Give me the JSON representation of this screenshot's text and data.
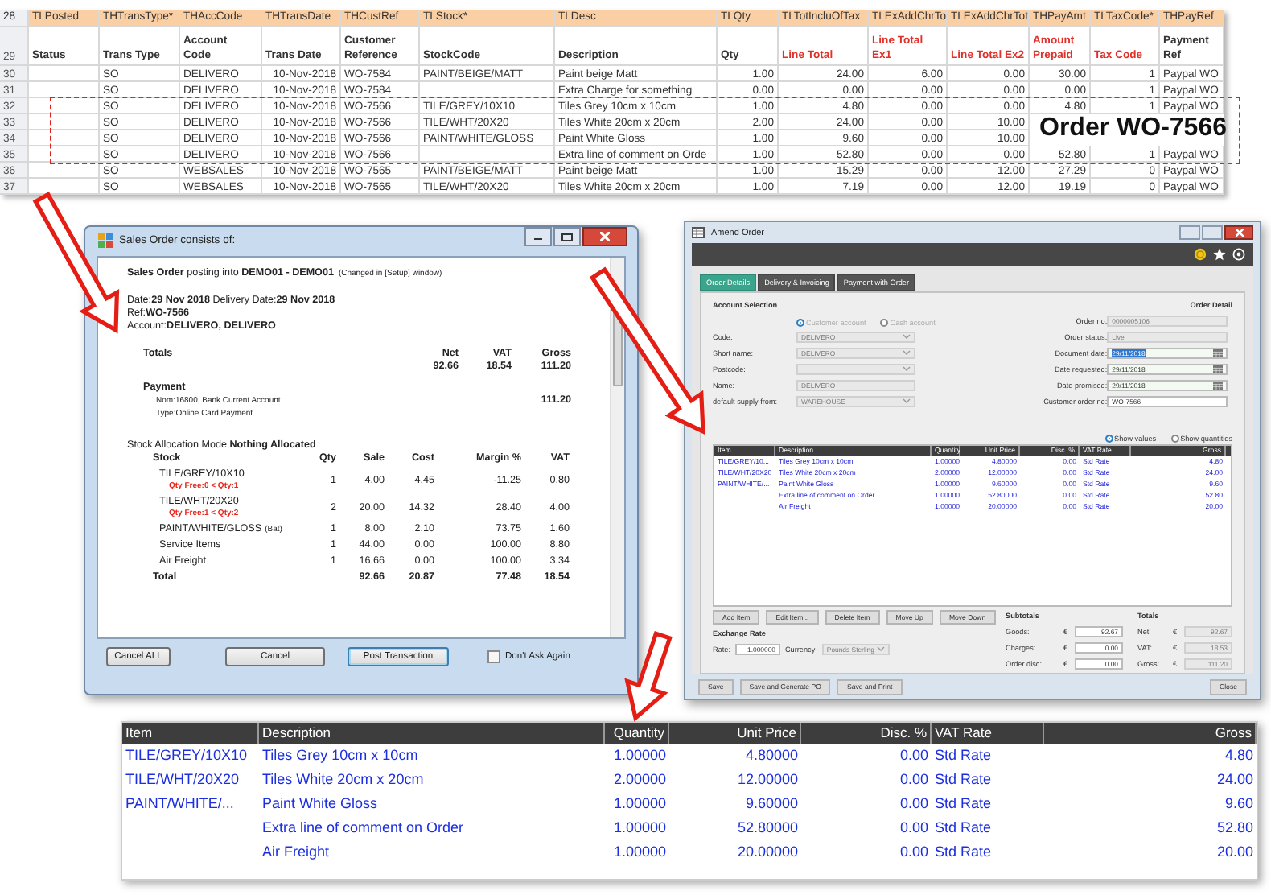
{
  "spreadsheet": {
    "field_row": {
      "row_number": "28",
      "cells": [
        "TLPosted",
        "THTransType*",
        "THAccCode",
        "THTransDate",
        "THCustRef",
        "TLStock*",
        "TLDesc",
        "TLQty",
        "TLTotIncluOfTax",
        "TLExAddChrTo",
        "TLExAddChrTot",
        "THPayAmt",
        "TLTaxCode*",
        "THPayRef"
      ]
    },
    "header_row": {
      "row_number": "29",
      "cells": [
        {
          "text": "Status",
          "highlighted": false
        },
        {
          "text": "Trans Type",
          "highlighted": false
        },
        {
          "text": "Account Code",
          "highlighted": false
        },
        {
          "text": "Trans Date",
          "highlighted": false
        },
        {
          "text": "Customer Reference",
          "highlighted": false
        },
        {
          "text": "StockCode",
          "highlighted": false
        },
        {
          "text": "Description",
          "highlighted": false
        },
        {
          "text": "Qty",
          "highlighted": false
        },
        {
          "text": "Line Total",
          "highlighted": true
        },
        {
          "text": "Line Total Ex1",
          "highlighted": true
        },
        {
          "text": "Line Total Ex2",
          "highlighted": true
        },
        {
          "text": "Amount Prepaid",
          "highlighted": true
        },
        {
          "text": "Tax Code",
          "highlighted": true
        },
        {
          "text": "Payment Ref",
          "highlighted": false
        }
      ]
    },
    "rows": [
      {
        "row_number": "30",
        "cells": [
          null,
          "SO",
          "DELIVERO",
          "10-Nov-2018",
          "WO-7584",
          "PAINT/BEIGE/MATT",
          "Paint beige Matt",
          "1.00",
          "24.00",
          "6.00",
          "0.00",
          "30.00",
          "1",
          "Paypal WO"
        ]
      },
      {
        "row_number": "31",
        "cells": [
          null,
          "SO",
          "DELIVERO",
          "10-Nov-2018",
          "WO-7584",
          null,
          "Extra Charge for something",
          "0.00",
          "0.00",
          "0.00",
          "0.00",
          "0.00",
          "1",
          "Paypal WO"
        ]
      },
      {
        "row_number": "32",
        "cells": [
          null,
          "SO",
          "DELIVERO",
          "10-Nov-2018",
          "WO-7566",
          "TILE/GREY/10X10",
          "Tiles Grey 10cm x 10cm",
          "1.00",
          "4.80",
          "0.00",
          "0.00",
          "4.80",
          "1",
          "Paypal WO"
        ]
      },
      {
        "row_number": "33",
        "cells": [
          null,
          "SO",
          "DELIVERO",
          "10-Nov-2018",
          "WO-7566",
          "TILE/WHT/20X20",
          "Tiles White 20cm x 20cm",
          "2.00",
          "24.00",
          "0.00",
          "10.00",
          null,
          null,
          null
        ]
      },
      {
        "row_number": "34",
        "cells": [
          null,
          "SO",
          "DELIVERO",
          "10-Nov-2018",
          "WO-7566",
          "PAINT/WHITE/GLOSS",
          "Paint White Gloss",
          "1.00",
          "9.60",
          "0.00",
          "10.00",
          null,
          null,
          null
        ]
      },
      {
        "row_number": "35",
        "cells": [
          null,
          "SO",
          "DELIVERO",
          "10-Nov-2018",
          "WO-7566",
          null,
          "Extra line of comment on Orde",
          "1.00",
          "52.80",
          "0.00",
          "0.00",
          "52.80",
          "1",
          "Paypal WO"
        ]
      },
      {
        "row_number": "36",
        "cells": [
          null,
          "SO",
          "WEBSALES",
          "10-Nov-2018",
          "WO-7565",
          "PAINT/BEIGE/MATT",
          "Paint beige Matt",
          "1.00",
          "15.29",
          "0.00",
          "12.00",
          "27.29",
          "0",
          "Paypal WO"
        ]
      },
      {
        "row_number": "37",
        "cells": [
          null,
          "SO",
          "WEBSALES",
          "10-Nov-2018",
          "WO-7565",
          "TILE/WHT/20X20",
          "Tiles White 20cm x 20cm",
          "1.00",
          "7.19",
          "0.00",
          "12.00",
          "19.19",
          "0",
          "Paypal WO"
        ]
      }
    ],
    "callout": "Order WO-7566"
  },
  "sales_order_dialog": {
    "title": "Sales Order consists of:",
    "heading": "**Sales Order** posting into **DEMO01 - DEMO01**",
    "heading_note": "(Changed in [Setup] window)",
    "dates": "Date:**29 Nov 2018** Delivery Date:**29 Nov 2018**",
    "ref": "Ref:**WO-7566**",
    "account": "Account:**DELIVERO, DELIVERO**",
    "totals": {
      "label": "Totals",
      "columns": [
        "Net",
        "VAT",
        "Gross"
      ],
      "values": [
        "92.66",
        "18.54",
        "111.20"
      ]
    },
    "payment": {
      "label": "Payment",
      "lines": [
        "Nom:16800, Bank Current Account",
        "Type:Online Card Payment"
      ],
      "amount": "111.20"
    },
    "allocation_mode": "Stock Allocation Mode **Nothing Allocated**",
    "stock": {
      "columns": [
        "Stock",
        "Qty",
        "Sale",
        "Cost",
        "Margin %",
        "VAT"
      ],
      "rows": [
        {
          "name": "TILE/GREY/10X10",
          "warning": "Qty Free:0 < Qty:1",
          "values": [
            "1",
            "4.00",
            "4.45",
            "-11.25",
            "0.80"
          ]
        },
        {
          "name": "TILE/WHT/20X20",
          "warning": "Qty Free:1 < Qty:2",
          "values": [
            "2",
            "20.00",
            "14.32",
            "28.40",
            "4.00"
          ]
        },
        {
          "name": "PAINT/WHITE/GLOSS",
          "note": "(Bat)",
          "values": [
            "1",
            "8.00",
            "2.10",
            "73.75",
            "1.60"
          ]
        },
        {
          "name": "Service Items",
          "values": [
            "1",
            "44.00",
            "0.00",
            "100.00",
            "8.80"
          ]
        },
        {
          "name": "Air Freight",
          "values": [
            "1",
            "16.66",
            "0.00",
            "100.00",
            "3.34"
          ]
        }
      ],
      "total": {
        "label": "Total",
        "values": [
          "92.66",
          "20.87",
          "77.48",
          "18.54"
        ]
      }
    },
    "buttons": [
      {
        "label": "Cancel ALL",
        "default": false
      },
      {
        "label": "Cancel",
        "default": false
      },
      {
        "label": "Post Transaction",
        "default": true
      }
    ],
    "dont_ask_again": {
      "label": "Don't Ask Again",
      "checked": false
    }
  },
  "amend_order_window": {
    "title": "Amend Order",
    "tabs": [
      {
        "label": "Order Details",
        "selected": true
      },
      {
        "label": "Delivery & Invoicing",
        "selected": false
      },
      {
        "label": "Payment with Order",
        "selected": false
      }
    ],
    "account_section": {
      "title": "Account Selection",
      "account_types": [
        {
          "label": "Customer account",
          "selected": true
        },
        {
          "label": "Cash account",
          "selected": false
        }
      ],
      "fields": [
        {
          "label": "Code:",
          "value": "DELIVERO",
          "kind": "dropdown",
          "disabled": true
        },
        {
          "label": "Short name:",
          "value": "DELIVERO",
          "kind": "dropdown",
          "disabled": true
        },
        {
          "label": "Postcode:",
          "kind": "dropdown",
          "disabled": true
        },
        {
          "label": "Name:",
          "value": "DELIVERO",
          "kind": "text",
          "disabled": true
        },
        {
          "label": "default supply from:",
          "value": "WAREHOUSE",
          "kind": "dropdown",
          "disabled": true
        }
      ]
    },
    "order_section": {
      "title": "Order Detail",
      "fields": [
        {
          "label": "Order no:",
          "value": "0000005106",
          "kind": "text",
          "disabled": true
        },
        {
          "label": "Order status:",
          "value": "Live",
          "kind": "text",
          "disabled": true
        },
        {
          "label": "Document date:",
          "value": "29/11/2018",
          "kind": "date",
          "disabled": false,
          "highlighted": true
        },
        {
          "label": "Date requested:",
          "value": "29/11/2018",
          "kind": "date",
          "disabled": false,
          "highlighted": false
        },
        {
          "label": "Date promised:",
          "value": "29/11/2018",
          "kind": "date",
          "disabled": false,
          "highlighted": false
        },
        {
          "label": "Customer order no:",
          "value": "WO-7566",
          "kind": "text",
          "disabled": false
        }
      ]
    },
    "view_options": [
      {
        "label": "Show values",
        "selected": true
      },
      {
        "label": "Show quantities",
        "selected": false
      }
    ],
    "grid": {
      "columns": [
        "Item",
        "Description",
        "Quantity",
        "Unit Price",
        "Disc. %",
        "VAT Rate",
        "Gross"
      ],
      "rows": [
        {
          "item": "TILE/GREY/10...",
          "description": "Tiles Grey 10cm x 10cm",
          "quantity": "1.00000",
          "unit_price": "4.80000",
          "discount": "0.00",
          "vat_rate": "Std Rate",
          "gross": "4.80"
        },
        {
          "item": "TILE/WHT/20X20",
          "description": "Tiles White 20cm x 20cm",
          "quantity": "2.00000",
          "unit_price": "12.00000",
          "discount": "0.00",
          "vat_rate": "Std Rate",
          "gross": "24.00"
        },
        {
          "item": "PAINT/WHITE/...",
          "description": "Paint White Gloss",
          "quantity": "1.00000",
          "unit_price": "9.60000",
          "discount": "0.00",
          "vat_rate": "Std Rate",
          "gross": "9.60"
        },
        {
          "description": "Extra line of comment on Order",
          "quantity": "1.00000",
          "unit_price": "52.80000",
          "discount": "0.00",
          "vat_rate": "Std Rate",
          "gross": "52.80"
        },
        {
          "description": "Air Freight",
          "quantity": "1.00000",
          "unit_price": "20.00000",
          "discount": "0.00",
          "vat_rate": "Std Rate",
          "gross": "20.00"
        }
      ]
    },
    "item_buttons": [
      "Add Item",
      "Edit Item...",
      "Delete Item",
      "Move Up",
      "Move Down"
    ],
    "exchange_rate": {
      "title": "Exchange Rate",
      "rate_label": "Rate:",
      "rate": "1.000000",
      "currency_label": "Currency:",
      "currency": "Pounds Sterling"
    },
    "subtotals": {
      "title": "Subtotals",
      "fields": [
        {
          "label": "Goods:",
          "currency": "€",
          "value": "92.67"
        },
        {
          "label": "Charges:",
          "currency": "€",
          "value": "0.00"
        },
        {
          "label": "Order disc:",
          "currency": "€",
          "value": "0.00"
        }
      ]
    },
    "totals": {
      "title": "Totals",
      "fields": [
        {
          "label": "Net:",
          "currency": "€",
          "value": "92.67"
        },
        {
          "label": "VAT:",
          "currency": "€",
          "value": "18.53"
        },
        {
          "label": "Gross:",
          "currency": "€",
          "value": "111.20"
        }
      ]
    },
    "footer_buttons": [
      "Save",
      "Save and Generate PO",
      "Save and Print",
      "Close"
    ]
  },
  "zoomed_grid": {
    "columns": [
      "Item",
      "Description",
      "Quantity",
      "Unit Price",
      "Disc. %",
      "VAT Rate",
      "Gross"
    ],
    "rows": [
      {
        "item": "TILE/GREY/10X10",
        "description": "Tiles Grey 10cm x 10cm",
        "quantity": "1.00000",
        "unit_price": "4.80000",
        "discount": "0.00",
        "vat_rate": "Std Rate",
        "gross": "4.80"
      },
      {
        "item": "TILE/WHT/20X20",
        "description": "Tiles White 20cm x 20cm",
        "quantity": "2.00000",
        "unit_price": "12.00000",
        "discount": "0.00",
        "vat_rate": "Std Rate",
        "gross": "24.00"
      },
      {
        "item": "PAINT/WHITE/...",
        "description": "Paint White Gloss",
        "quantity": "1.00000",
        "unit_price": "9.60000",
        "discount": "0.00",
        "vat_rate": "Std Rate",
        "gross": "9.60"
      },
      {
        "description": "Extra line of comment on Order",
        "quantity": "1.00000",
        "unit_price": "52.80000",
        "discount": "0.00",
        "vat_rate": "Std Rate",
        "gross": "52.80"
      },
      {
        "description": "Air Freight",
        "quantity": "1.00000",
        "unit_price": "20.00000",
        "discount": "0.00",
        "vat_rate": "Std Rate",
        "gross": "20.00"
      }
    ]
  }
}
